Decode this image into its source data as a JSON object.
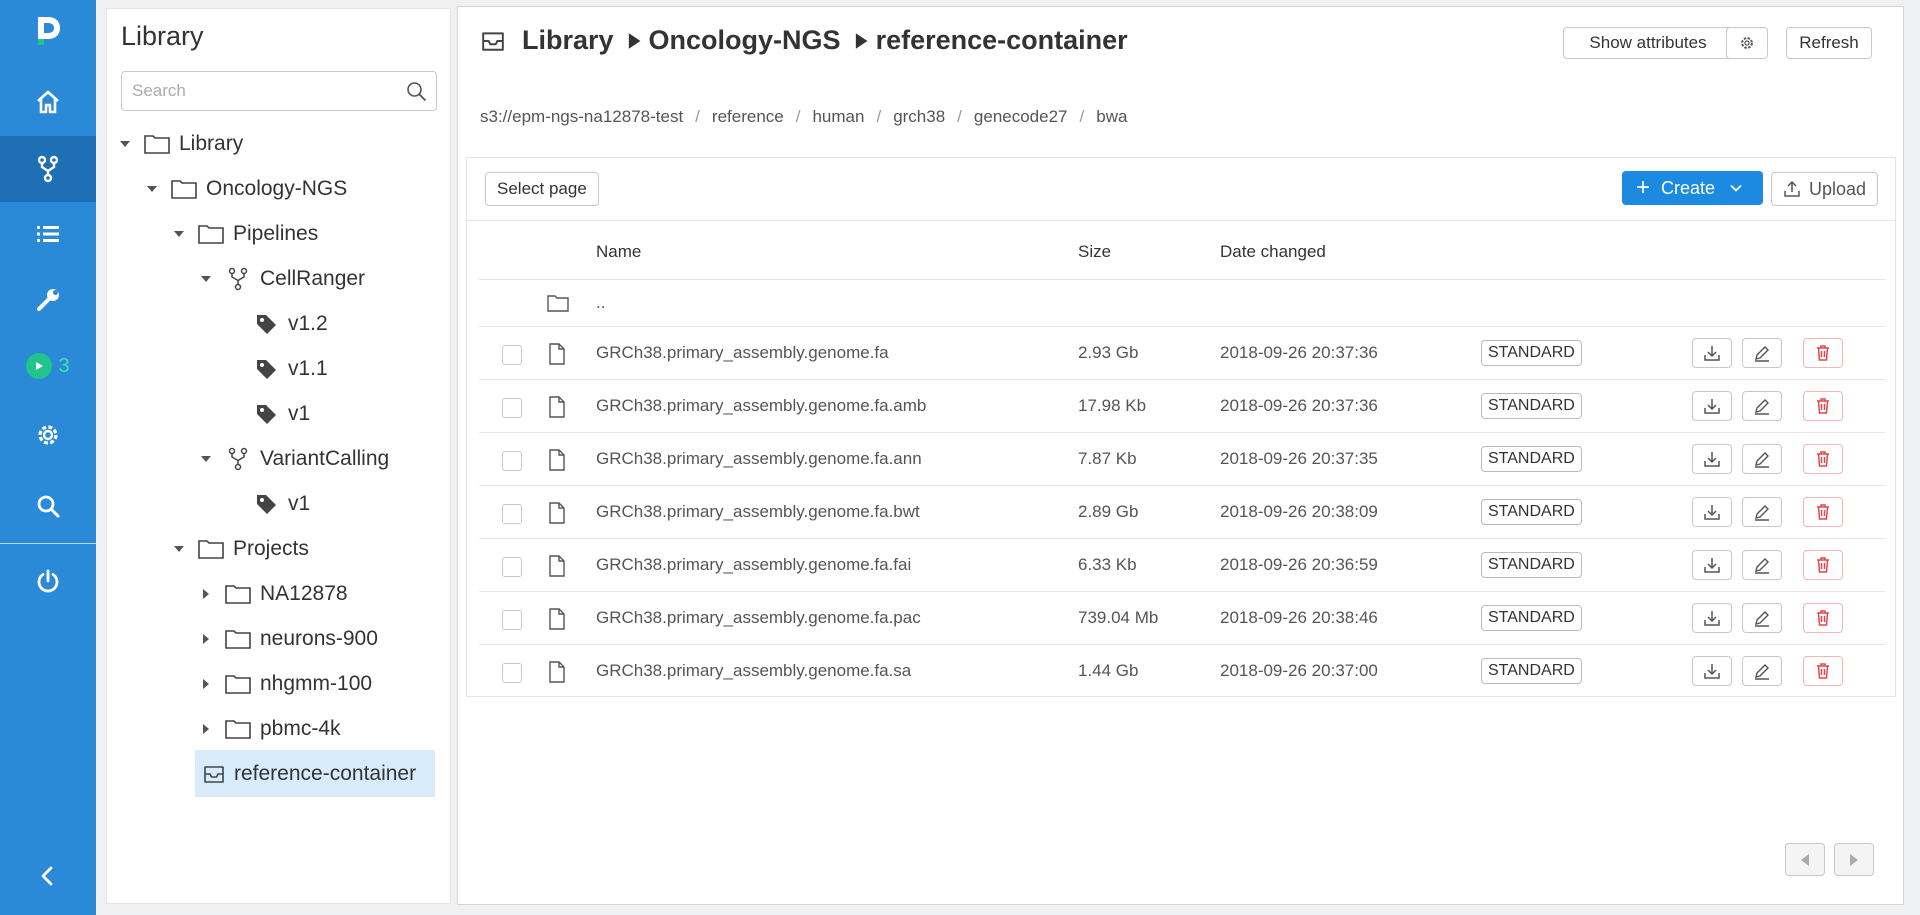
{
  "nav": {
    "items": [
      {
        "icon": "home-icon"
      },
      {
        "icon": "pipelines-icon",
        "active": true
      },
      {
        "icon": "list-icon"
      },
      {
        "icon": "tools-icon"
      },
      {
        "icon": "runs-icon",
        "count": "3"
      },
      {
        "icon": "settings-icon"
      },
      {
        "icon": "search-icon"
      },
      {
        "icon": "logout-icon"
      }
    ],
    "collapse_icon": "chevron-left-icon"
  },
  "library": {
    "title": "Library",
    "search_placeholder": "Search",
    "tree": {
      "library": "Library",
      "oncology": "Oncology-NGS",
      "pipelines": "Pipelines",
      "cellranger": "CellRanger",
      "cr_v12": "v1.2",
      "cr_v11": "v1.1",
      "cr_v1": "v1",
      "variantcalling": "VariantCalling",
      "vc_v1": "v1",
      "projects": "Projects",
      "na12878": "NA12878",
      "neurons": "neurons-900",
      "nhgmm": "nhgmm-100",
      "pbmc": "pbmc-4k",
      "reference": "reference-container"
    }
  },
  "main": {
    "breadcrumb": [
      "Library",
      "Oncology-NGS",
      "reference-container"
    ],
    "buttons": {
      "show_attributes": "Show attributes",
      "refresh": "Refresh",
      "select_page": "Select page",
      "create": "Create",
      "upload": "Upload"
    },
    "path": [
      "s3://epm-ngs-na12878-test",
      "reference",
      "human",
      "grch38",
      "genecode27",
      "bwa"
    ],
    "table": {
      "headers": {
        "name": "Name",
        "size": "Size",
        "date": "Date changed"
      },
      "parent_row": "..",
      "rows": [
        {
          "name": "GRCh38.primary_assembly.genome.fa",
          "size": "2.93 Gb",
          "date": "2018-09-26 20:37:36",
          "storage_class": "STANDARD"
        },
        {
          "name": "GRCh38.primary_assembly.genome.fa.amb",
          "size": "17.98 Kb",
          "date": "2018-09-26 20:37:36",
          "storage_class": "STANDARD"
        },
        {
          "name": "GRCh38.primary_assembly.genome.fa.ann",
          "size": "7.87 Kb",
          "date": "2018-09-26 20:37:35",
          "storage_class": "STANDARD"
        },
        {
          "name": "GRCh38.primary_assembly.genome.fa.bwt",
          "size": "2.89 Gb",
          "date": "2018-09-26 20:38:09",
          "storage_class": "STANDARD"
        },
        {
          "name": "GRCh38.primary_assembly.genome.fa.fai",
          "size": "6.33 Kb",
          "date": "2018-09-26 20:36:59",
          "storage_class": "STANDARD"
        },
        {
          "name": "GRCh38.primary_assembly.genome.fa.pac",
          "size": "739.04 Mb",
          "date": "2018-09-26 20:38:46",
          "storage_class": "STANDARD"
        },
        {
          "name": "GRCh38.primary_assembly.genome.fa.sa",
          "size": "1.44 Gb",
          "date": "2018-09-26 20:37:00",
          "storage_class": "STANDARD"
        }
      ]
    }
  },
  "colors": {
    "nav_bg": "#2a8ad8",
    "nav_active": "#1f6fb6",
    "primary": "#1b8ae0",
    "runs_green": "#21c48a",
    "delete_red": "#e0484a",
    "selected_bg": "#d8ebfb"
  }
}
